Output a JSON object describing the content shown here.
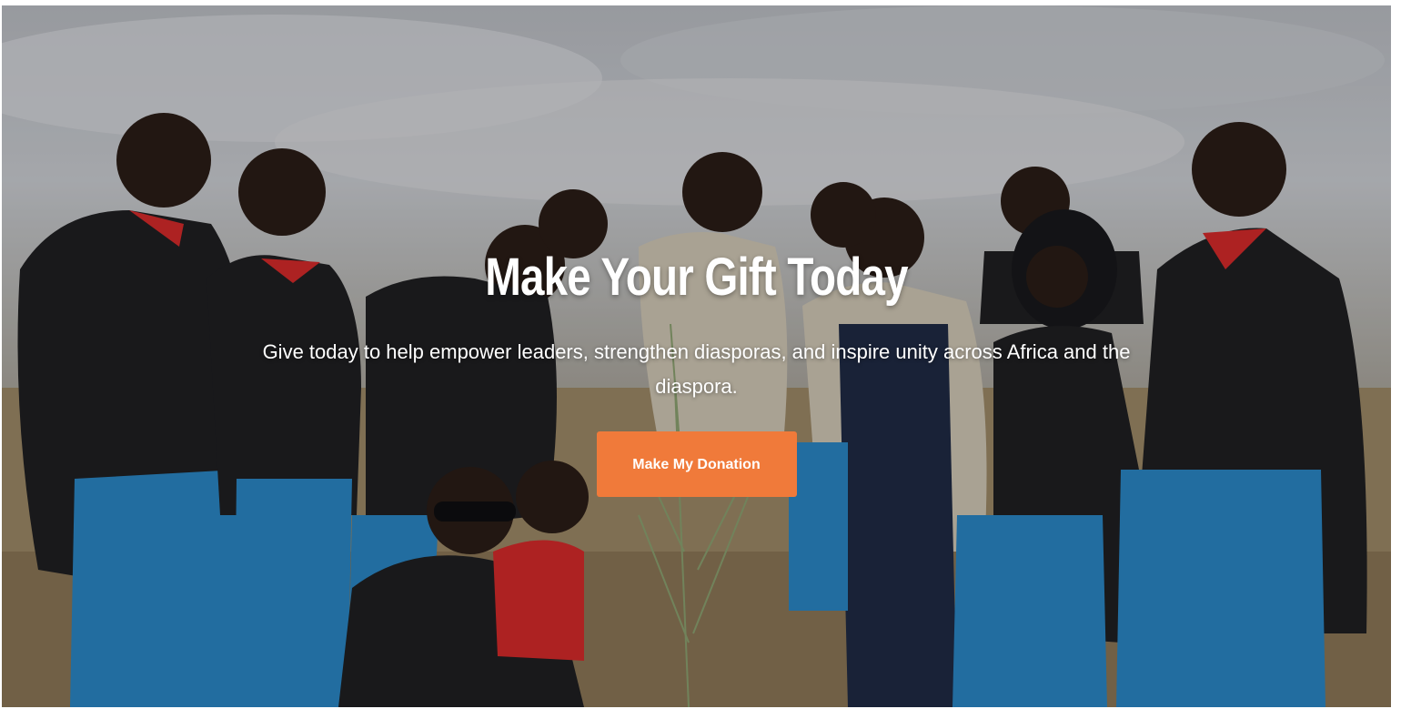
{
  "hero": {
    "title": "Make Your Gift Today",
    "subtitle": "Give today to help empower leaders, strengthen diasporas, and inspire unity across Africa and the diaspora.",
    "cta_label": "Make My Donation",
    "photo_description_icon": "group-photo-icon"
  },
  "colors": {
    "accent": "#f07a3a",
    "text": "#ffffff",
    "blazer": "#1f1f22",
    "skirt": "#2a86c4",
    "collar": "#d42a2a",
    "vest": "#cfc6b4",
    "dress_navy": "#1f2a44"
  }
}
